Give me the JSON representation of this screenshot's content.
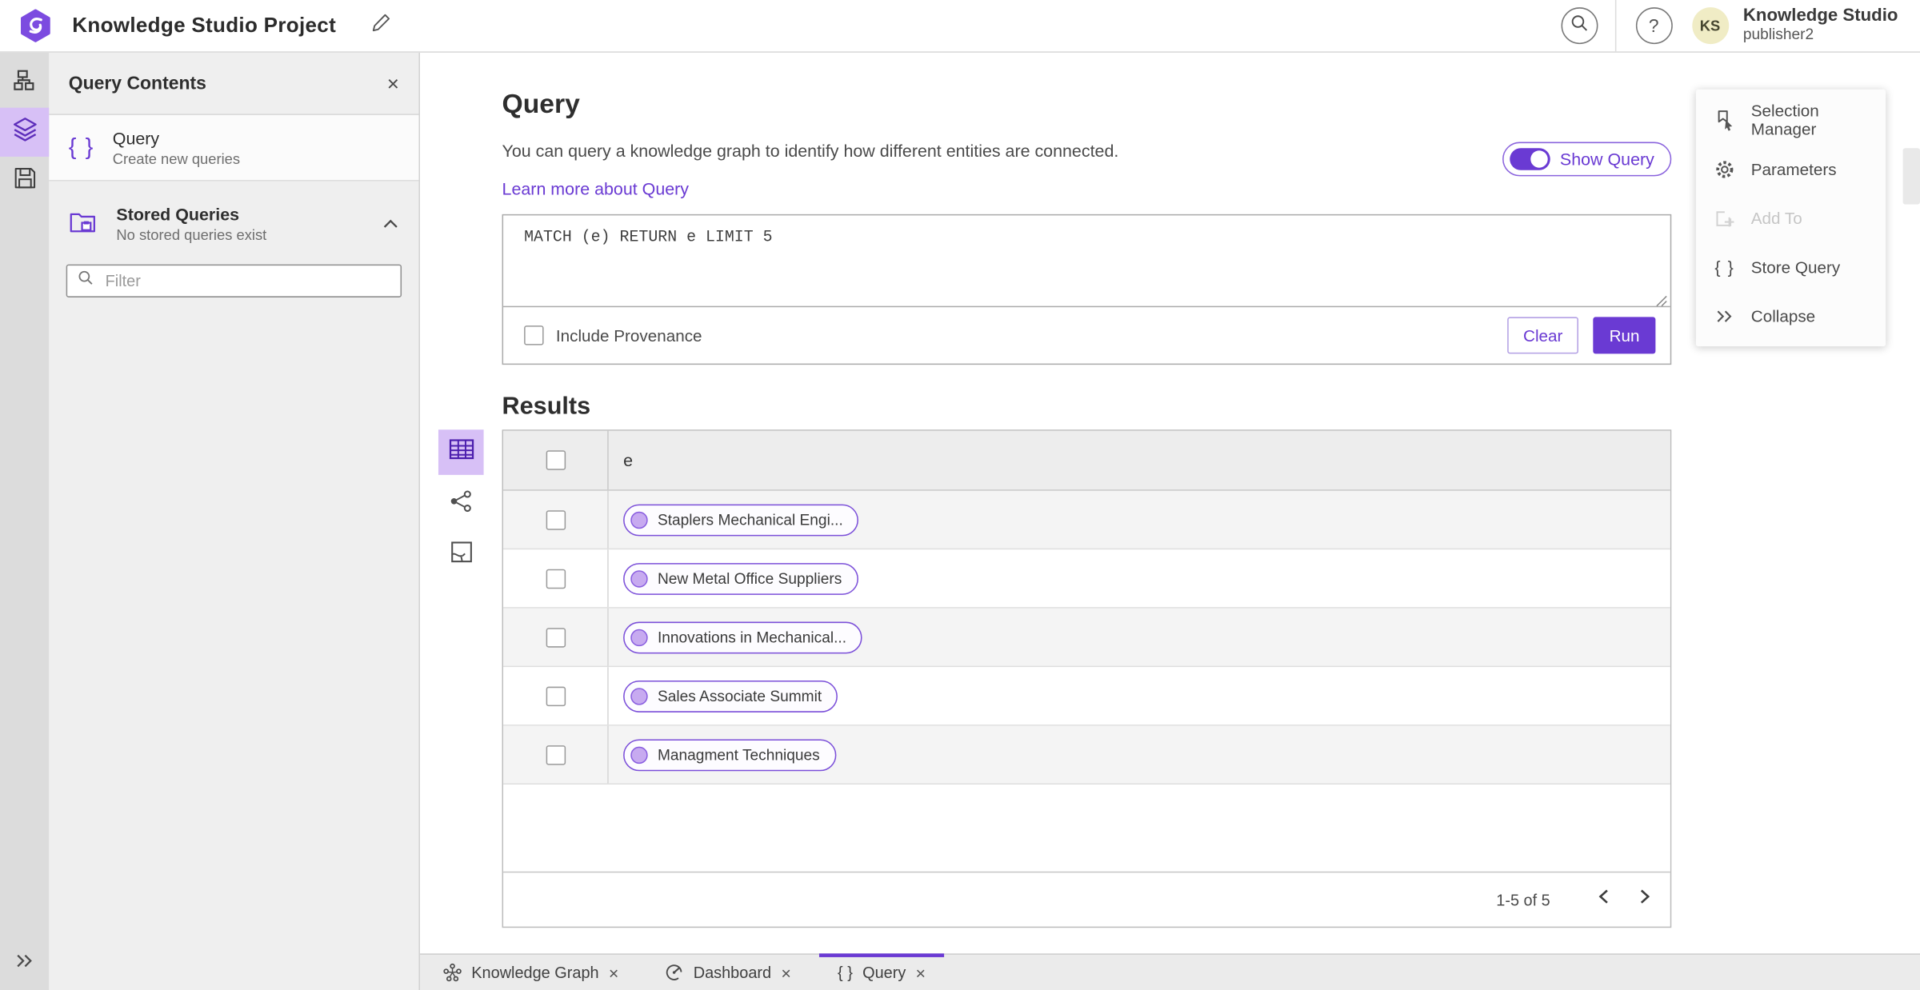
{
  "header": {
    "title": "Knowledge Studio Project",
    "product": "Knowledge Studio",
    "username": "publisher2",
    "avatar_initials": "KS",
    "help_glyph": "?"
  },
  "panel": {
    "title": "Query Contents",
    "query_item": {
      "title": "Query",
      "subtitle": "Create new queries"
    },
    "stored_item": {
      "title": "Stored Queries",
      "subtitle": "No stored queries exist"
    },
    "filter_placeholder": "Filter"
  },
  "query": {
    "heading": "Query",
    "description": "You can query a knowledge graph to identify how different entities are connected.",
    "learn_more": "Learn more about Query",
    "show_query": "Show Query",
    "text": "MATCH (e) RETURN e LIMIT 5",
    "include_provenance": "Include Provenance",
    "clear": "Clear",
    "run": "Run"
  },
  "results": {
    "heading": "Results",
    "column": "e",
    "rows": [
      "Staplers Mechanical Engi...",
      "New Metal Office Suppliers",
      "Innovations in Mechanical...",
      "Sales Associate Summit",
      "Managment Techniques"
    ],
    "page_info": "1-5 of 5"
  },
  "tools": {
    "items": [
      {
        "label": "Selection Manager"
      },
      {
        "label": "Parameters"
      },
      {
        "label": "Add To"
      },
      {
        "label": "Store Query"
      },
      {
        "label": "Collapse"
      }
    ]
  },
  "tabs": [
    {
      "label": "Knowledge Graph"
    },
    {
      "label": "Dashboard"
    },
    {
      "label": "Query"
    }
  ],
  "icons": {
    "braces": "{ }",
    "close": "×"
  },
  "colors": {
    "accent": "#6a3ad3",
    "accent_selected_bg": "#d7c0f6",
    "chip_fill": "#c7aaf0",
    "avatar_bg": "#f0ecc5"
  }
}
